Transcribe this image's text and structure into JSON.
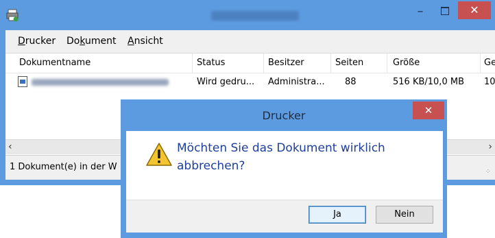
{
  "window": {
    "title_blurred": "RICOH SP 1 0000",
    "minimize_glyph": "–",
    "close_glyph": "✕",
    "icon": "printer-icon"
  },
  "menu": {
    "items": [
      {
        "label": "Drucker"
      },
      {
        "label": "Dokument"
      },
      {
        "label": "Ansicht"
      }
    ]
  },
  "table": {
    "columns": [
      "Dokumentname",
      "Status",
      "Besitzer",
      "Seiten",
      "Größe",
      "Ge"
    ],
    "rows": [
      {
        "status": "Wird gedru...",
        "owner": "Administra...",
        "pages": "88",
        "size": "516 KB/10,0 MB",
        "submitted": "10:"
      }
    ]
  },
  "statusbar": {
    "text": "1 Dokument(e) in der W"
  },
  "dialog": {
    "title": "Drucker",
    "message": "Möchten Sie das Dokument wirklich abbrechen?",
    "yes_label": "Ja",
    "no_label": "Nein",
    "close_glyph": "✕",
    "icon": "warning-icon"
  },
  "colors": {
    "titlebar": "#5d9be0",
    "close_button": "#c75050",
    "message_text": "#1d3f9a"
  }
}
